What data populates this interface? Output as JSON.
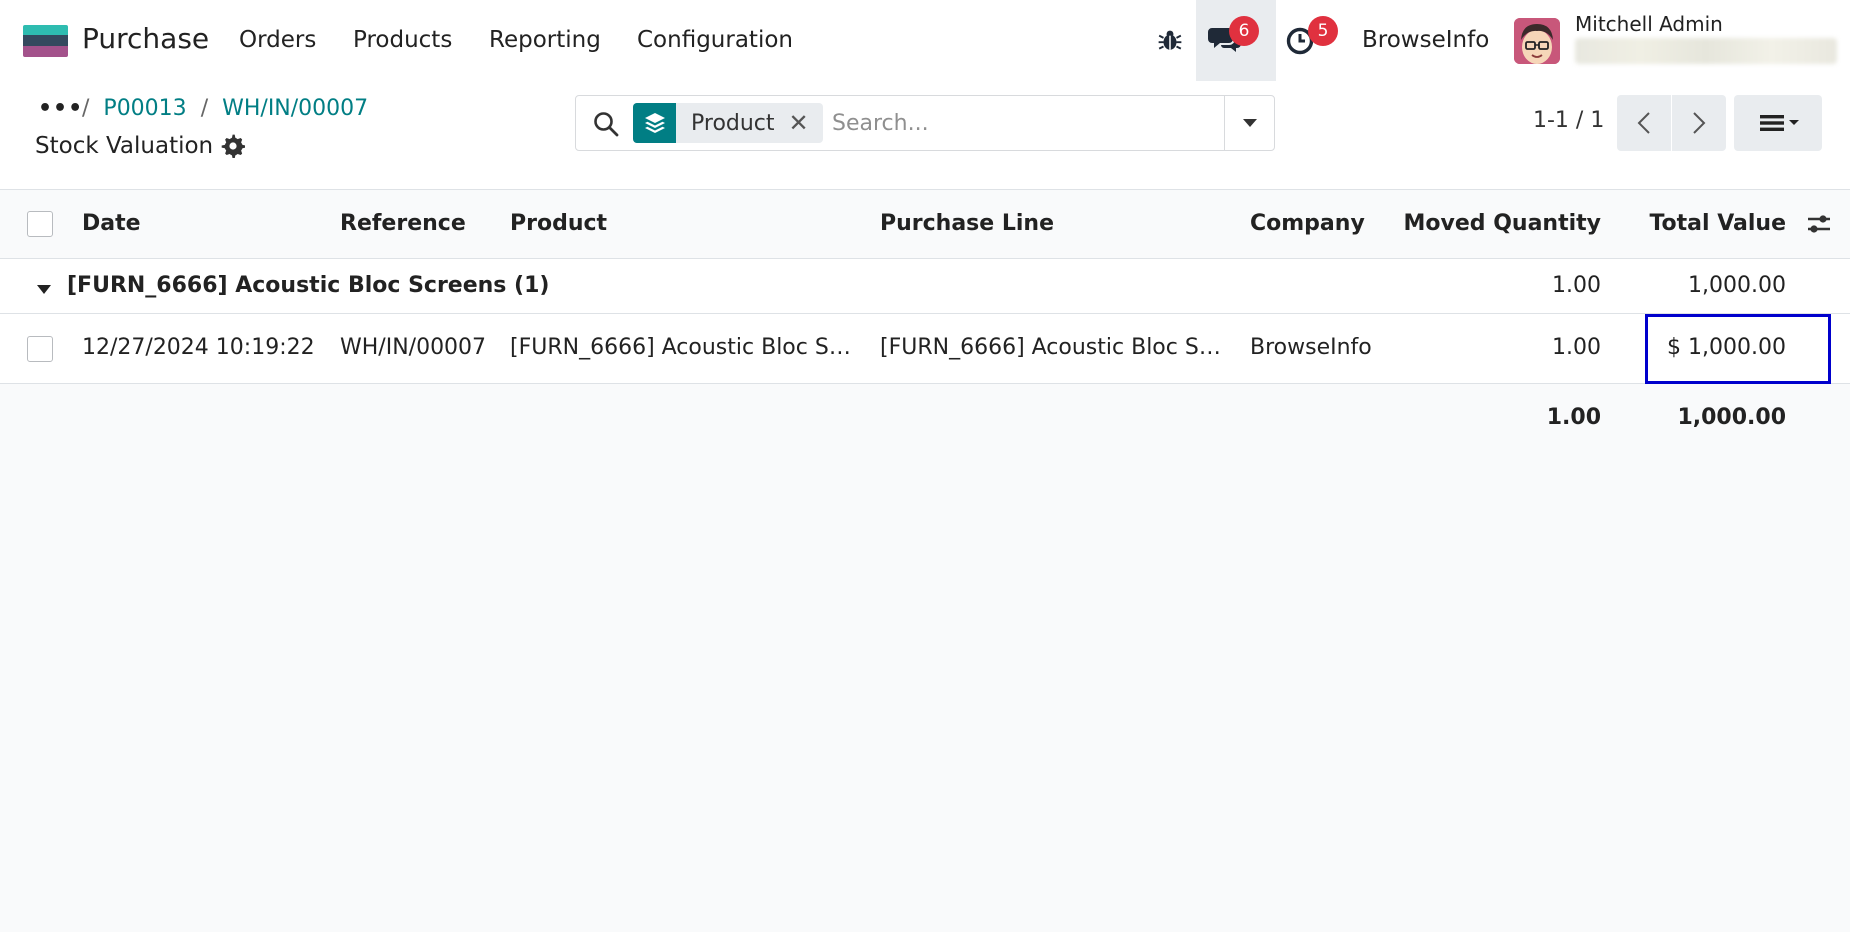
{
  "navbar": {
    "app_name": "Purchase",
    "menu": [
      "Orders",
      "Products",
      "Reporting",
      "Configuration"
    ],
    "messages_count": "6",
    "activities_count": "5",
    "company": "BrowseInfo",
    "user_name": "Mitchell Admin"
  },
  "breadcrumb": {
    "items": [
      "P00013",
      "WH/IN/00007"
    ],
    "current": "Stock Valuation"
  },
  "search": {
    "facet_label": "Product",
    "placeholder": "Search..."
  },
  "pager": {
    "value": "1-1 / 1"
  },
  "table": {
    "columns": [
      "Date",
      "Reference",
      "Product",
      "Purchase Line",
      "Company",
      "Moved Quantity",
      "Total Value"
    ],
    "group": {
      "label": "[FURN_6666] Acoustic Bloc Screens (1)",
      "moved_quantity": "1.00",
      "total_value": "1,000.00"
    },
    "rows": [
      {
        "date": "12/27/2024 10:19:22",
        "reference": "WH/IN/00007",
        "product": "[FURN_6666] Acoustic Bloc Screens",
        "purchase_line": "[FURN_6666] Acoustic Bloc Screens",
        "company": "BrowseInfo",
        "moved_quantity": "1.00",
        "total_value": "$ 1,000.00"
      }
    ],
    "totals": {
      "moved_quantity": "1.00",
      "total_value": "1,000.00"
    }
  },
  "colors": {
    "accent": "#017e84",
    "badge": "#e0313f",
    "highlight": "#0000cc"
  }
}
